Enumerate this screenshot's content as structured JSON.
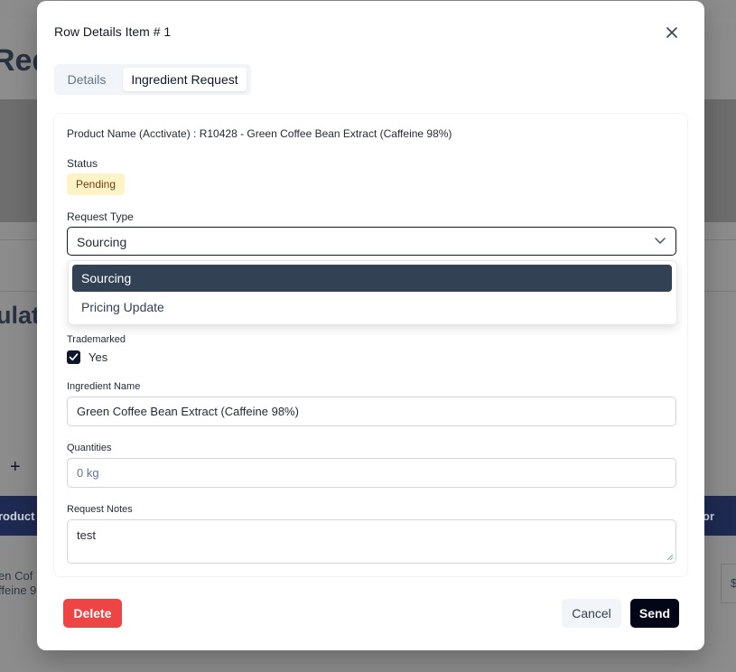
{
  "background": {
    "page_title_fragment": "Req",
    "section_title_fragment": "ulat",
    "add_symbol": "+",
    "table_headers": [
      "roduct",
      "or"
    ],
    "table_cell_line1": "en Cof",
    "table_cell_line2": "ffeine 9",
    "right_cell": "$"
  },
  "modal": {
    "title": "Row Details Item # 1",
    "tabs": [
      {
        "label": "Details",
        "active": false
      },
      {
        "label": "Ingredient Request",
        "active": true
      }
    ],
    "product_line": "Product Name (Acctivate) : R10428 - Green Coffee Bean Extract (Caffeine 98%)",
    "status_label": "Status",
    "status_value": "Pending",
    "request_type_label": "Request Type",
    "request_type_value": "Sourcing",
    "request_type_options": [
      "Sourcing",
      "Pricing Update"
    ],
    "trademarked_label": "Trademarked",
    "trademarked_checked": true,
    "trademarked_option": "Yes",
    "ingredient_name_label": "Ingredient Name",
    "ingredient_name_value": "Green Coffee Bean Extract (Caffeine 98%)",
    "quantities_label": "Quantities",
    "quantities_placeholder": "0 kg",
    "request_notes_label": "Request Notes",
    "request_notes_value": "test",
    "buttons": {
      "delete": "Delete",
      "cancel": "Cancel",
      "send": "Send"
    }
  },
  "colors": {
    "delete": "#ef4444",
    "send": "#020617",
    "selected_option": "#334155",
    "badge_bg": "#fef3c7"
  }
}
